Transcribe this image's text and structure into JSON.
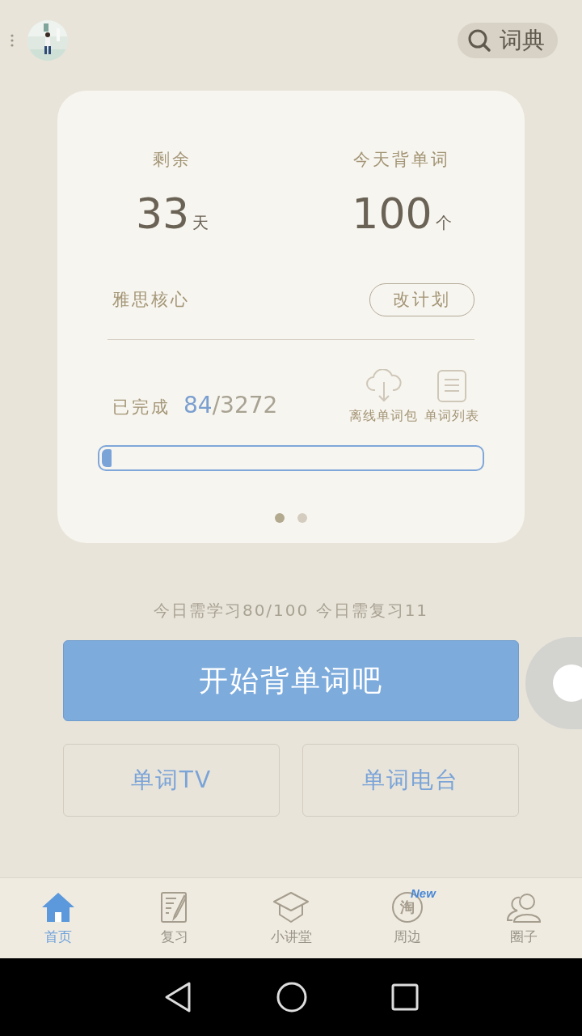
{
  "header": {
    "dictionary_button": "词典"
  },
  "plan_card": {
    "remaining_label": "剩余",
    "remaining_value": "33",
    "remaining_unit": "天",
    "today_label": "今天背单词",
    "today_value": "100",
    "today_unit": "个",
    "book": "雅思核心",
    "change_plan_button": "改计划",
    "completed_label": "已完成",
    "completed_count": "84",
    "total_count": "/3272",
    "actions": [
      {
        "label": "离线单词包",
        "kind": "cloud"
      },
      {
        "label": "单词列表",
        "kind": "list"
      }
    ],
    "progress": {
      "level": 0.026
    },
    "pages": [
      {
        "selected": true
      },
      {
        "selected": false
      }
    ]
  },
  "today_summary": "今日需学习80/100  今日需复习11",
  "start_button": "开始背单词吧",
  "secondary_buttons": [
    "单词TV",
    "单词电台"
  ],
  "tabs": [
    {
      "label": "首页",
      "kind": "home",
      "selected": true
    },
    {
      "label": "复习",
      "kind": "review",
      "selected": false
    },
    {
      "label": "小讲堂",
      "kind": "class",
      "selected": false
    },
    {
      "label": "周边",
      "kind": "shop",
      "selected": false,
      "glyph": "淘",
      "badge": "New"
    },
    {
      "label": "圈子",
      "kind": "people",
      "selected": false
    }
  ]
}
